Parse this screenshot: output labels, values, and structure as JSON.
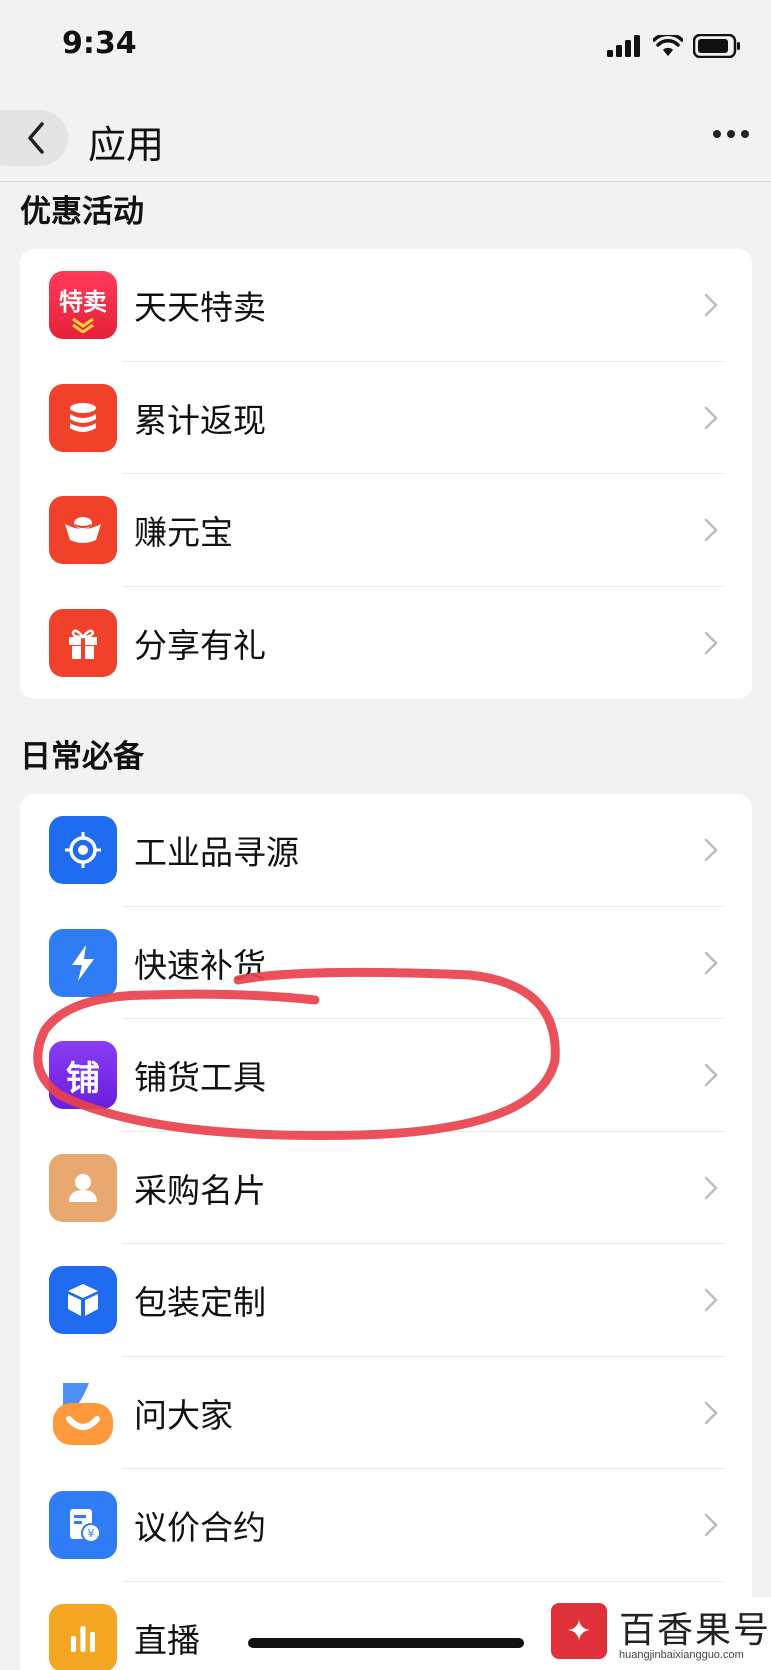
{
  "status_bar": {
    "time": "9:34"
  },
  "nav": {
    "title": "应用"
  },
  "sections": [
    {
      "title": "优惠活动",
      "items": [
        {
          "label": "天天特卖",
          "icon": "te-mai-icon",
          "icon_text": "特卖",
          "color": "#ef2a4a"
        },
        {
          "label": "累计返现",
          "icon": "coin-stack-icon",
          "color": "#f2412b"
        },
        {
          "label": "赚元宝",
          "icon": "gold-ingot-icon",
          "color": "#f2412b"
        },
        {
          "label": "分享有礼",
          "icon": "gift-icon",
          "color": "#f2412b"
        }
      ]
    },
    {
      "title": "日常必备",
      "items": [
        {
          "label": "工业品寻源",
          "icon": "crosshair-icon",
          "color": "#1f6cf0"
        },
        {
          "label": "快速补货",
          "icon": "lightning-icon",
          "color": "#2f7cf5"
        },
        {
          "label": "铺货工具",
          "icon": "pu-icon",
          "icon_text": "铺",
          "color": "#7b2cf0"
        },
        {
          "label": "采购名片",
          "icon": "person-card-icon",
          "color": "#e8a870"
        },
        {
          "label": "包装定制",
          "icon": "box-icon",
          "color": "#1f6cf0"
        },
        {
          "label": "问大家",
          "icon": "chat-smile-icon",
          "color": "#2f7cf5"
        },
        {
          "label": "议价合约",
          "icon": "contract-icon",
          "color": "#2f7cf5"
        },
        {
          "label": "直播",
          "icon": "live-bars-icon",
          "color": "#f5a623"
        }
      ]
    }
  ],
  "watermark": {
    "title": "百香果号",
    "url": "huangjinbaixiangguo.com"
  },
  "annotation": {
    "color": "#e8424c",
    "target": "铺货工具"
  }
}
